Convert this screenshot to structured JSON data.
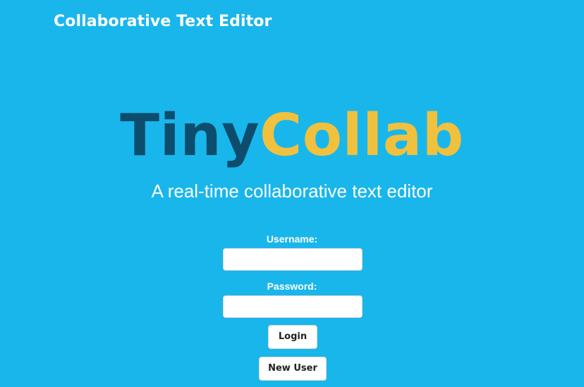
{
  "header": {
    "title": "Collaborative Text Editor"
  },
  "hero": {
    "logo_part_1": "Tiny",
    "logo_part_2": "Collab",
    "tagline": "A real-time collaborative text editor"
  },
  "login_form": {
    "username_label": "Username:",
    "username_value": "",
    "password_label": "Password:",
    "password_value": "",
    "login_button": "Login",
    "new_user_button": "New User"
  },
  "colors": {
    "background": "#19b6ec",
    "logo_dark": "#0c4d6e",
    "logo_accent": "#f1c13e",
    "text": "#ffffff"
  }
}
